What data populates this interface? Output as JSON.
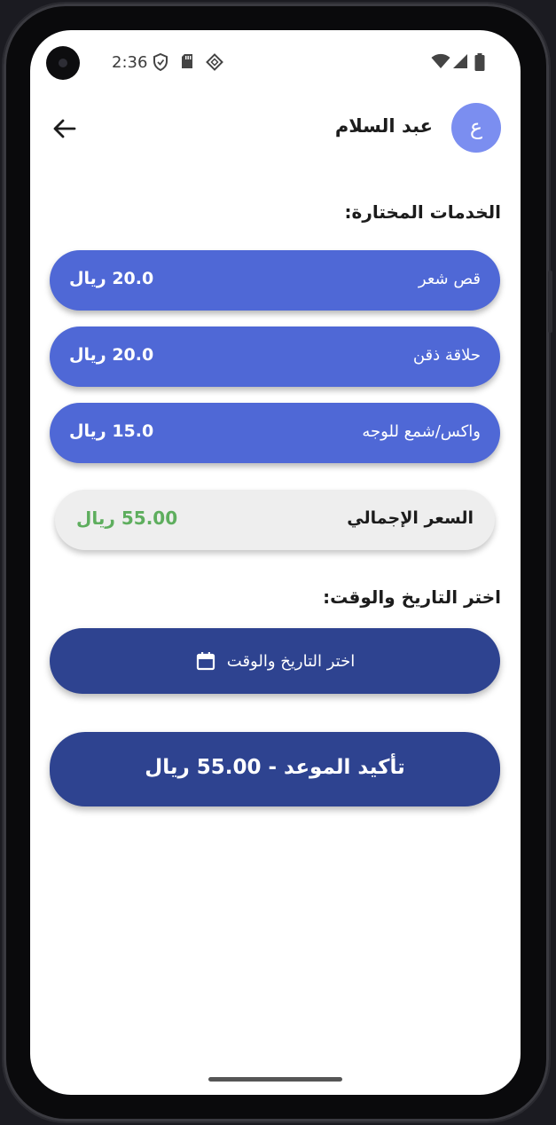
{
  "status_bar": {
    "time": "2:36"
  },
  "header": {
    "user_name": "عبد السلام",
    "avatar_letter": "ع"
  },
  "services_section": {
    "title": ":الخدمات المختارة",
    "items": [
      {
        "name": "قص شعر",
        "price": "20.0 ريال"
      },
      {
        "name": "حلاقة ذقن",
        "price": "20.0 ريال"
      },
      {
        "name": "واكس/شمع للوجه",
        "price": "15.0 ريال"
      }
    ]
  },
  "total": {
    "label": "السعر الإجمالي",
    "value": "55.00 ريال"
  },
  "datetime_section": {
    "title": ":اختر التاريخ والوقت",
    "button_label": "اختر التاريخ والوقت"
  },
  "confirm": {
    "label": "تأكيد الموعد - 55.00 ريال"
  },
  "colors": {
    "service_bg": "#4f68d6",
    "button_dark": "#2e4390",
    "avatar_bg": "#7b8ef0",
    "price_green": "#5eae5e"
  }
}
